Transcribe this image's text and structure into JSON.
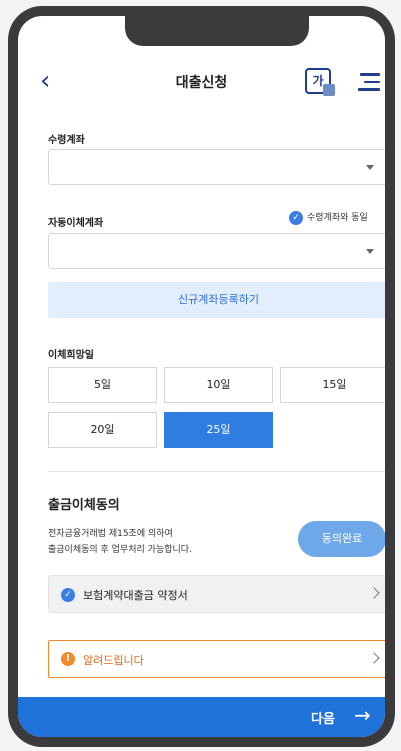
{
  "header": {
    "title": "대출신청",
    "font_button": "가"
  },
  "receiving_account": {
    "label": "수령계좌",
    "value": ""
  },
  "auto_transfer_account": {
    "label": "자동이체계좌",
    "value": "",
    "same_as_label": "수령계좌와 동일"
  },
  "register_button": "신규계좌등록하기",
  "transfer_day": {
    "label": "이체희망일",
    "options": [
      "5일",
      "10일",
      "15일",
      "20일",
      "25일"
    ],
    "selected": "25일"
  },
  "withdrawal_consent": {
    "title": "출금이체동의",
    "description_line1": "전자금융거래법 제15조에 의하여",
    "description_line2": "출금이체동의 후 업무처리 가능합니다.",
    "done_button": "동의완료",
    "document": "보험계약대출금 약정서"
  },
  "notice": "알려드립니다",
  "footer": {
    "next_label": "다음",
    "next_icon": "→"
  },
  "colors": {
    "primary": "#1f72d8",
    "accent": "#2f7de1",
    "warning": "#f08a2a",
    "navy": "#1f3d8c"
  }
}
